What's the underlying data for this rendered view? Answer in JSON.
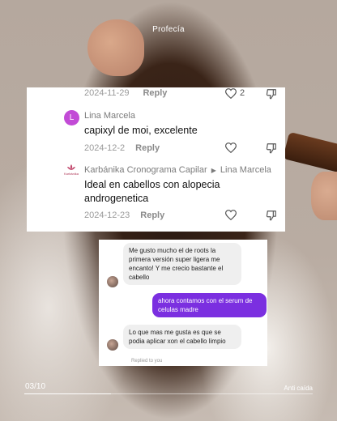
{
  "profile": {
    "name": "Profecía"
  },
  "comments": [
    {
      "date": "2024-11-29",
      "reply_label": "Reply",
      "likes": "2"
    },
    {
      "author": "Lina Marcela",
      "avatar_letter": "L",
      "text": "capixyl de moi, excelente",
      "date": "2024-12-2",
      "reply_label": "Reply"
    },
    {
      "author": "Karbánika Cronograma Capilar",
      "reply_to": "Lina Marcela",
      "avatar_text": "Karbánika",
      "text_line1": "Ideal en cabellos con alopecia",
      "text_line2": "androgenetica",
      "date": "2024-12-23",
      "reply_label": "Reply"
    }
  ],
  "chat": {
    "messages": [
      {
        "from": "them",
        "lines": [
          "Me gusto mucho el de roots la",
          "primera versión super ligera me",
          "encanto! Y me crecio bastante el",
          "cabello"
        ]
      },
      {
        "from": "me",
        "lines": [
          "ahora contamos con el serum de",
          "celulas madre"
        ]
      },
      {
        "from": "them",
        "lines": [
          "Lo que mas me gusta es que se",
          "podia aplicar xon el cabello limpio"
        ]
      }
    ],
    "replied_label": "Replied to you"
  },
  "footer": {
    "counter": "03/10",
    "label": "Anti caída",
    "progress": 0.3
  },
  "colors": {
    "accent_purple": "#7b2fe0",
    "avatar_purple": "#c24bd6"
  },
  "icons": {
    "like": "heart-outline-icon",
    "dislike": "thumbs-down-outline-icon"
  }
}
